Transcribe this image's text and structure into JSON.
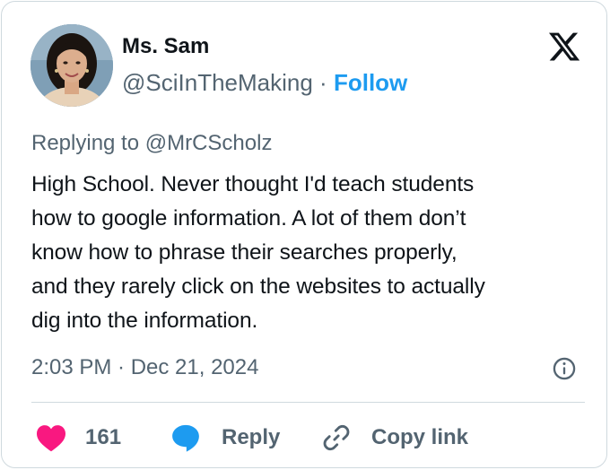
{
  "author": {
    "name": "Ms. Sam",
    "handle": "@SciInTheMaking",
    "separator": "·",
    "follow_label": "Follow"
  },
  "reply_context": "Replying to @MrCScholz",
  "tweet": {
    "lines": [
      "High School. Never thought I'd teach students",
      "how to google information. A lot of them don’t",
      "know how to phrase their searches properly,",
      "and they rarely click on the websites to actually",
      "dig into the information."
    ],
    "timestamp": "2:03 PM · Dec 21, 2024"
  },
  "actions": {
    "like_count": "161",
    "reply_label": "Reply",
    "copy_link_label": "Copy link"
  },
  "colors": {
    "accent": "#1d9bf0",
    "like": "#f91880",
    "muted": "#536471",
    "text": "#0f1419",
    "border": "#cfd9de"
  },
  "icons": {
    "brand": "x-logo-icon",
    "info": "info-icon",
    "like": "heart-icon",
    "reply": "speech-bubble-icon",
    "copy": "link-icon"
  }
}
